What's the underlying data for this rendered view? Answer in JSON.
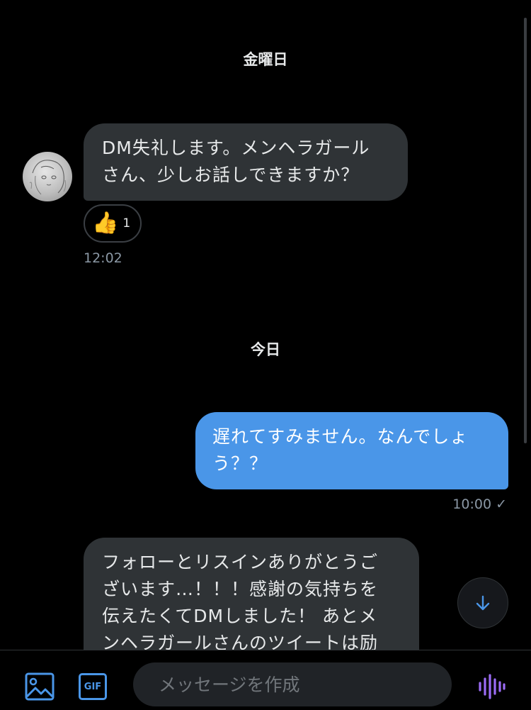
{
  "conversation": {
    "day_groups": [
      {
        "label": "金曜日"
      },
      {
        "label": "今日"
      }
    ],
    "messages": [
      {
        "direction": "incoming",
        "lines": [
          "DM失礼します。メンヘラガール",
          "さん、少しお話しできますか？"
        ],
        "reaction": {
          "emoji": "👍",
          "count": "1"
        },
        "time": "12:02"
      },
      {
        "direction": "outgoing",
        "lines": [
          "遅れてすみません。なんでしょ",
          "う？？"
        ],
        "time": "10:00 ✓"
      },
      {
        "direction": "incoming",
        "lines": [
          "フォローとリスインありがとうご",
          "ざいます…！！！感謝の気持ちを",
          "伝えたくてDMしました！ あとメ",
          "ンヘラガールさんのツイートは励"
        ]
      }
    ]
  },
  "composer": {
    "placeholder": "メッセージを作成",
    "gif_label": "GIF"
  },
  "icons": {
    "image": "image-icon",
    "gif": "gif-icon",
    "voice": "voice-wave-icon",
    "scroll_down": "arrow-down-icon"
  },
  "colors": {
    "accent": "#4a96e8",
    "bubble_incoming": "#2f3336",
    "voice_icon": "#9b6cf5"
  }
}
